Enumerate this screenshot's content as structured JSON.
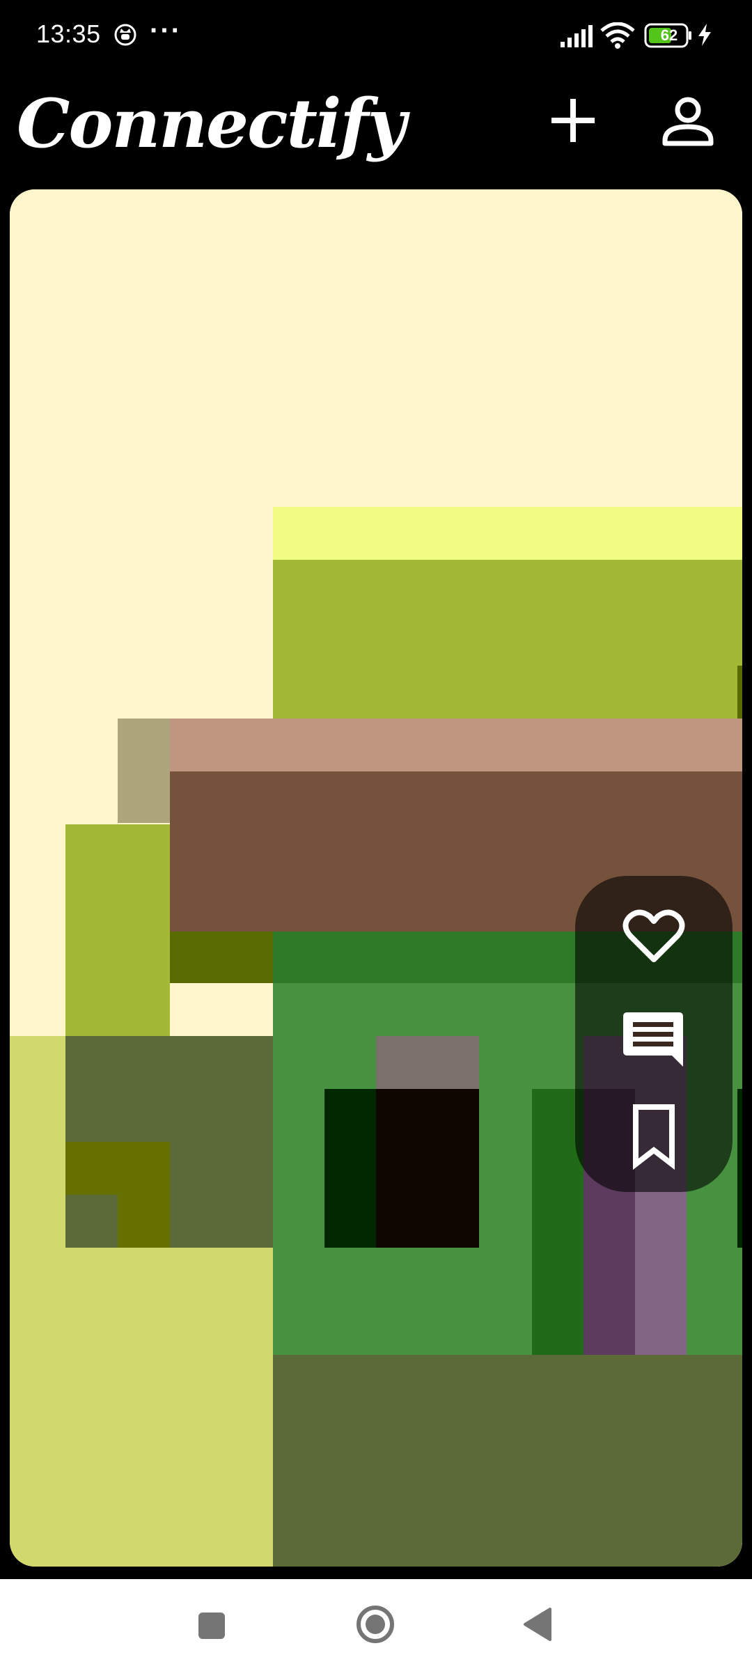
{
  "status_bar": {
    "time": "13:35",
    "more": "···",
    "battery_level": "62",
    "icons": [
      "cat-notification-icon",
      "signal-icon",
      "wifi-icon",
      "battery-icon",
      "charging-icon"
    ]
  },
  "header": {
    "title": "Connectify",
    "actions": [
      "add-icon",
      "profile-icon"
    ]
  },
  "post": {
    "image_description": "pixel-art-house",
    "actions": [
      "heart-icon",
      "comment-icon",
      "bookmark-icon"
    ]
  },
  "nav_bar": {
    "buttons": [
      "recents-icon",
      "home-icon",
      "back-icon"
    ]
  },
  "colors": {
    "background": "#000000",
    "card_bg": "#fef5cb",
    "nav_bg": "#ffffff",
    "nav_icon": "#757575"
  }
}
